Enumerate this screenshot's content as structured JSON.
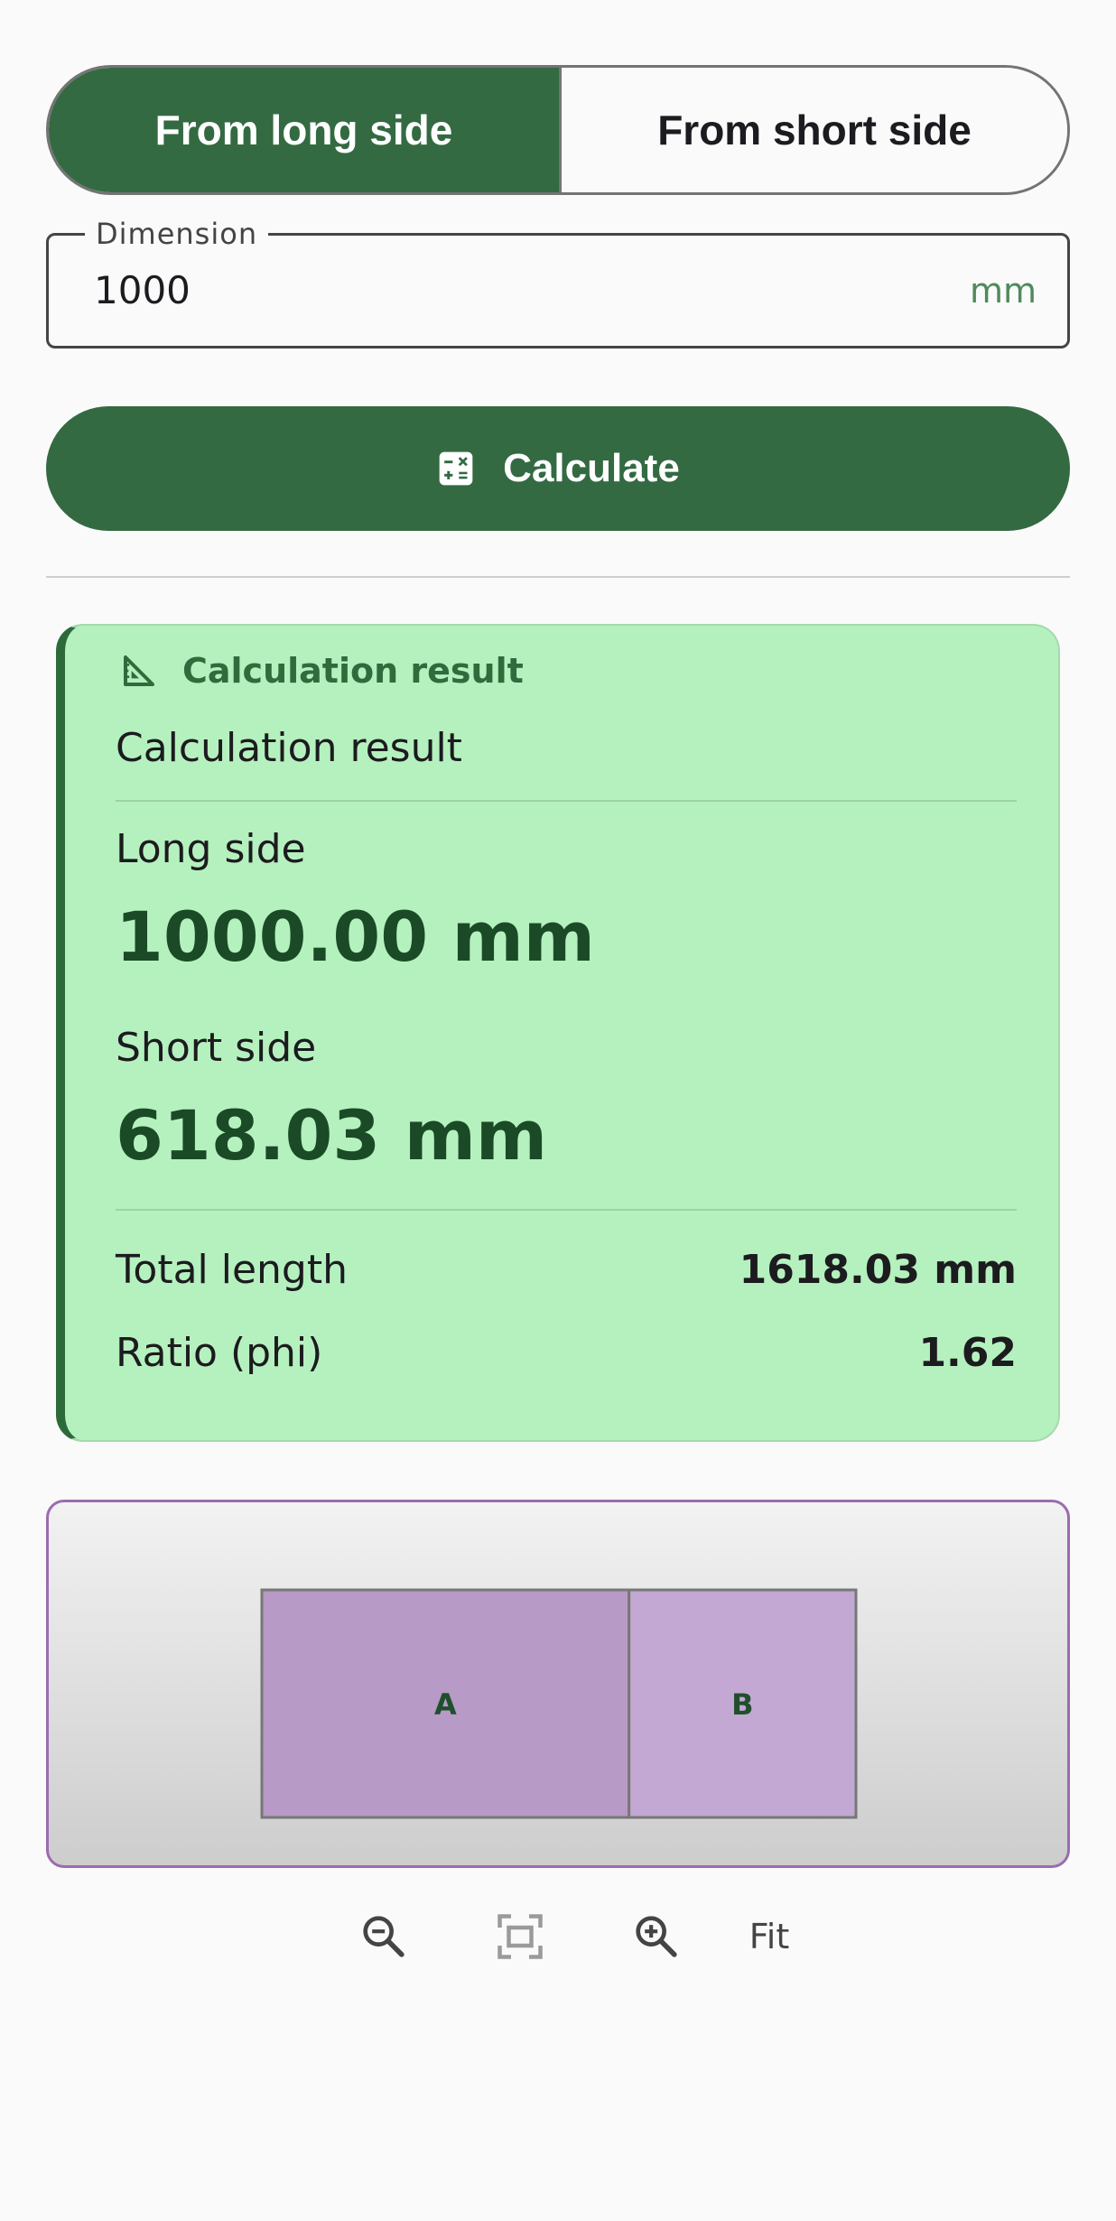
{
  "mode_toggle": {
    "options": [
      "From long side",
      "From short side"
    ],
    "selected": "From long side"
  },
  "dimension_field": {
    "label": "Dimension",
    "value": "1000",
    "suffix": "mm"
  },
  "calculate_button": {
    "label": "Calculate",
    "icon": "calculator-icon"
  },
  "result_card": {
    "header": "Calculation result",
    "header_icon": "set-square-icon",
    "subtitle": "Calculation result",
    "long_side": {
      "label": "Long side",
      "value": "1000.00 mm"
    },
    "short_side": {
      "label": "Short side",
      "value": "618.03 mm"
    },
    "total_length": {
      "label": "Total length",
      "value": "1618.03 mm"
    },
    "ratio": {
      "label": "Ratio (phi)",
      "value": "1.62"
    }
  },
  "visualization": {
    "segments": [
      {
        "label": "A",
        "length": 1000.0
      },
      {
        "label": "B",
        "length": 618.03
      }
    ]
  },
  "zoom_controls": {
    "zoom_out_icon": "zoom-out-icon",
    "fit_icon": "fit-screen-icon",
    "zoom_in_icon": "zoom-in-icon",
    "fit_label": "Fit"
  },
  "colors": {
    "primary": "#336a42",
    "card_bg": "#b5f1be",
    "accent_purple": "#9b6cb0",
    "segment_a": "#b79ac6",
    "segment_b": "#c2a8d2"
  }
}
